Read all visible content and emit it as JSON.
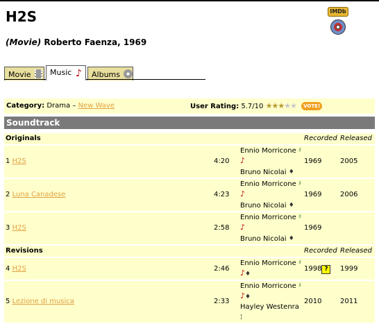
{
  "header": {
    "title": "H2S",
    "type_label": "(Movie)",
    "director_year": "Roberto Faenza, 1969"
  },
  "tabs": [
    {
      "label": "Movie",
      "icon": "film-icon"
    },
    {
      "label": "Music",
      "icon": "music-note-icon"
    },
    {
      "label": "Albums",
      "icon": "cd-icon"
    }
  ],
  "info": {
    "category_label": "Category:",
    "category_value": "Drama",
    "category_sep": "–",
    "category_link": "New Wave",
    "rating_label": "User Rating:",
    "rating_value": "5.7/10",
    "stars_filled": 3,
    "stars_total": 5,
    "vote_label": "VOTE!"
  },
  "soundtrack": {
    "heading": "Soundtrack",
    "originals_label": "Originals",
    "revisions_label": "Revisions",
    "recorded_col": "Recorded",
    "released_col": "Released",
    "originals": [
      {
        "num": "1",
        "title": "H2S",
        "time": "4:20",
        "artist_a": "Ennio Morricone",
        "artist_b": "Bruno Nicolai",
        "recorded": "1969",
        "released": "2005"
      },
      {
        "num": "2",
        "title": "Luna Canadese",
        "time": "4:23",
        "artist_a": "Ennio Morricone",
        "artist_b": "Bruno Nicolai",
        "recorded": "1969",
        "released": "2006"
      },
      {
        "num": "3",
        "title": "H2S",
        "time": "2:58",
        "artist_a": "Ennio Morricone",
        "artist_b": "Bruno Nicolai",
        "recorded": "1969",
        "released": ""
      }
    ],
    "revisions": [
      {
        "num": "4",
        "title": "H2S",
        "time": "2:46",
        "artist_a": "Ennio Morricone",
        "artist_b": "",
        "recorded": "1998",
        "released": "1999"
      },
      {
        "num": "5",
        "title": "Lezione di musica",
        "time": "2:33",
        "artist_a": "Ennio Morricone",
        "artist_b": "Hayley Westenra",
        "recorded": "2010",
        "released": "2011"
      }
    ]
  }
}
